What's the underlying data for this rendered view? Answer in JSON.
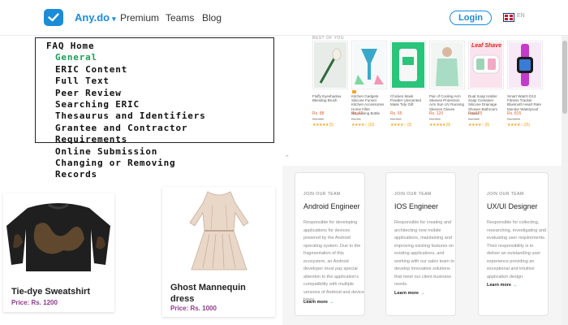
{
  "nav": {
    "brand": "Any.do",
    "links": [
      "Premium",
      "Teams",
      "Blog"
    ],
    "login": "Login",
    "language": "EN"
  },
  "faq": {
    "home": "FAQ Home",
    "items": [
      "General",
      "ERIC Content",
      "Full Text",
      "Peer Review",
      "Searching ERIC",
      "Thesaurus and Identifiers",
      "Grantee and Contractor",
      "Requirements",
      "Online Submission",
      "Changing or Removing",
      "Records"
    ],
    "active_item": "General",
    "active_color": "#1e9e55"
  },
  "products": {
    "label": "BEST OF YOU",
    "ad_badge": "Leaf Shave",
    "items": [
      {
        "name": "Fluffy Eyeshadow Blending Brush",
        "price": "Rs. 88",
        "old_price": "Rs. 120",
        "stars": "★★★★★ (5)",
        "icon": "brush-icon"
      },
      {
        "name": "Kitchen Gadgets Silicone Funnel Kitchen Accessories Home Filler Dispensing Bottle",
        "price": "Rs. 62",
        "old_price": "Rs. 95",
        "stars": "★★★★☆ (12)",
        "icon": "funnel-icon"
      },
      {
        "name": "Chicken Mask Powder Unscented Mask Tidy Gift",
        "price": "Rs. 65",
        "old_price": "Rs. 110",
        "stars": "★★★★☆ (3)",
        "icon": "pouch-icon"
      },
      {
        "name": "Pair of Cooling Arm Sleeves Protection Arm Sun UV Running Sleeves Gloves",
        "price": "Rs. 120",
        "old_price": "Rs. 199",
        "stars": "★★★★★ (9)",
        "icon": "sleeve-icon"
      },
      {
        "name": "Dual Soap Holder Soap Container Silicone Drainage Shower Bathroom Holder",
        "price": "Rs. 125",
        "old_price": "Rs. 180",
        "stars": "★★★★☆ (6)",
        "icon": "soap-holder-icon"
      },
      {
        "name": "Smart Watch D13 Fitness Tracker Bluetooth Heart Rate Monitor Waterproof",
        "price": "Rs. 815",
        "old_price": "Rs. 1299",
        "stars": "★★★★☆ (21)",
        "icon": "watch-icon"
      }
    ]
  },
  "fashion": [
    {
      "name": "Tie-dye Sweatshirt",
      "price": "Price: Rs. 1200",
      "icon": "sweatshirt-icon"
    },
    {
      "name": "Ghost Mannequin dress",
      "price": "Price: Rs. 1000",
      "icon": "dress-icon"
    }
  ],
  "jobs": {
    "kicker": "JOIN OUR TEAM",
    "more": "Learn more",
    "cards": [
      {
        "title": "Android Engineer",
        "desc": "Responsible for developing applications for devices powered by the Android operating system. Due to the fragmentation of this ecosystem, an Android developer must pay special attention to the application's compatibility with multiple versions of Android and device types."
      },
      {
        "title": "IOS Engineer",
        "desc": "Responsible for creating and architecting new mobile applications, maintaining and improving existing features on existing applications, and working with our sales team to develop innovative solutions that meet our client business needs."
      },
      {
        "title": "UX/UI Designer",
        "desc": "Responsible for collecting, researching, investigating and evaluating user requirements. Their responsibility is to deliver an outstanding user experience providing an exceptional and intuitive application design."
      }
    ]
  },
  "colors": {
    "accent": "#1a8cd8",
    "price_purple": "#8e3a8c",
    "link_green": "#1e9e55"
  }
}
